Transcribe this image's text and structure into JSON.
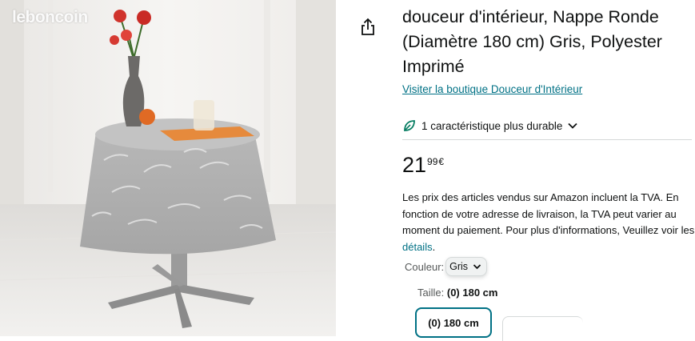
{
  "image": {
    "watermark": "leboncoin",
    "alt_name": "product-photo"
  },
  "share": {
    "icon": "share-icon"
  },
  "product": {
    "title": "douceur d'intérieur, Nappe Ronde (Diamètre 180 cm) Gris, Polyester Imprimé",
    "store_link": "Visiter la boutique Douceur d'Intérieur",
    "sustainability": "1 caractéristique plus durable"
  },
  "price": {
    "whole": "21",
    "fraction": "99",
    "currency": "€"
  },
  "vat": {
    "text": "Les prix des articles vendus sur Amazon incluent la TVA. En fonction de votre adresse de livraison, la TVA peut varier au moment du paiement. Pour plus d'informations, Veuillez voir les ",
    "link": "détails",
    "end": "."
  },
  "color": {
    "label": "Couleur:",
    "value": "Gris"
  },
  "size": {
    "label": "Taille:",
    "value": "(0) 180 cm",
    "tile": "(0) 180 cm"
  },
  "colors": {
    "link": "#007185",
    "text": "#0f1111",
    "muted": "#565959",
    "sustain_green": "#067d62"
  }
}
